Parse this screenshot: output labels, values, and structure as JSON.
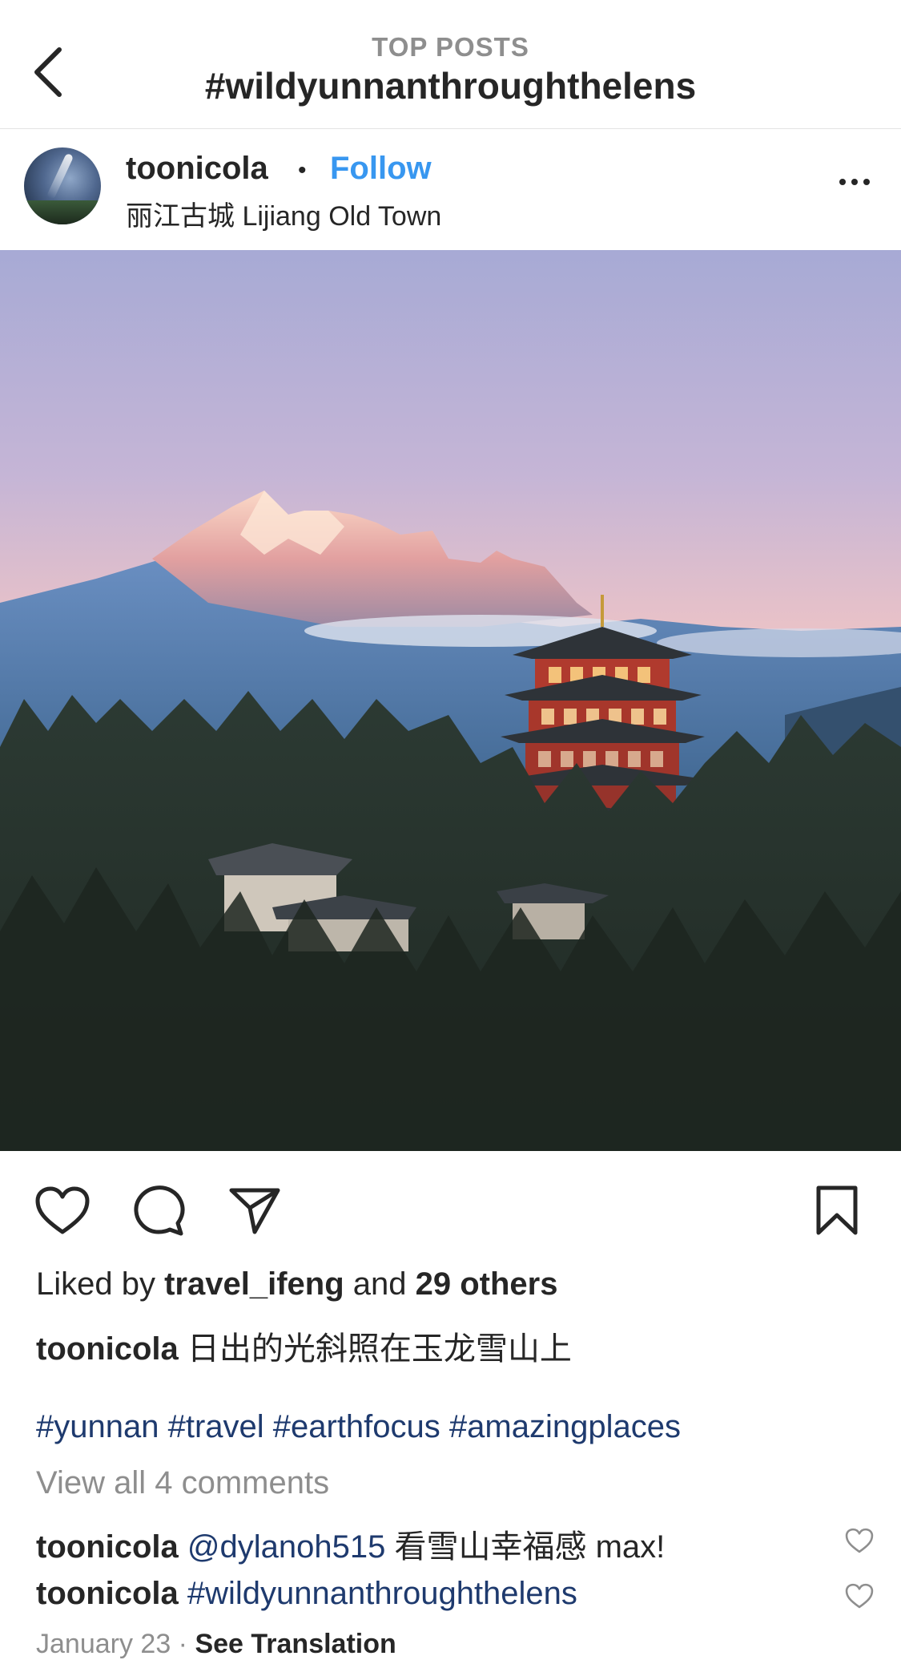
{
  "header": {
    "back_icon": "chevron-left-icon",
    "subtitle": "TOP POSTS",
    "title": "#wildyunnanthroughthelens"
  },
  "post": {
    "username": "toonicola",
    "separator": "•",
    "follow_label": "Follow",
    "location": "丽江古城 Lijiang Old Town",
    "more_icon": "more-dots-icon",
    "image_icon": "photo-pagoda-mountain"
  },
  "actions": {
    "like_icon": "heart-icon",
    "comment_icon": "comment-icon",
    "share_icon": "send-icon",
    "save_icon": "bookmark-icon"
  },
  "likes": {
    "prefix": "Liked by ",
    "user": "travel_ifeng",
    "middle": " and ",
    "others": "29 others"
  },
  "caption": {
    "user": "toonicola",
    "text": " 日出的光斜照在玉龙雪山上",
    "hashtags": "#yunnan #travel #earthfocus #amazingplaces"
  },
  "view_comments": "View all 4 comments",
  "comments": [
    {
      "user": "toonicola",
      "mention": " @dylanoh515",
      "text": " 看雪山幸福感 max!"
    },
    {
      "user": "toonicola",
      "mention": " #wildyunnanthroughthelens",
      "text": ""
    }
  ],
  "footer": {
    "date": "January 23",
    "separator": " · ",
    "see_translation": "See Translation"
  },
  "colors": {
    "link_blue": "#3897f0",
    "hashtag_navy": "#1e3a6e",
    "meta_gray": "#8e8e8e",
    "text": "#262626"
  }
}
